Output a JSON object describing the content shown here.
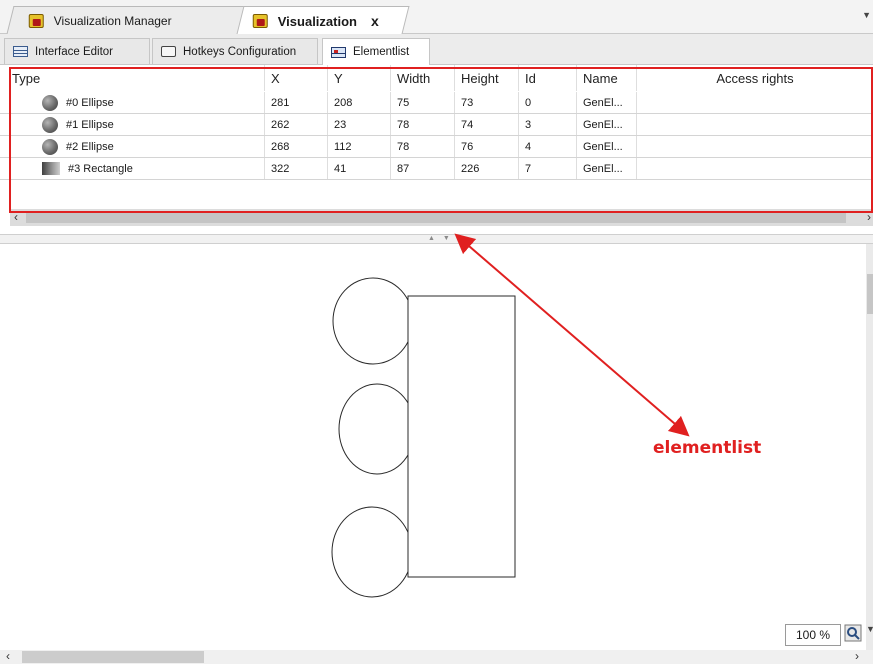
{
  "document_tabs": [
    {
      "label": "Visualization Manager",
      "icon": "visualization-manager-icon"
    },
    {
      "label": "Visualization",
      "icon": "visualization-icon",
      "active": true,
      "close": "x"
    }
  ],
  "editor_tabs": [
    {
      "label": "Interface Editor",
      "icon": "interface-editor-icon"
    },
    {
      "label": "Hotkeys Configuration",
      "icon": "keyboard-icon"
    },
    {
      "label": "Elementlist",
      "icon": "elementlist-icon",
      "active": true
    }
  ],
  "element_list": {
    "columns": [
      "Type",
      "X",
      "Y",
      "Width",
      "Height",
      "Id",
      "Name",
      "Access rights"
    ],
    "rows": [
      {
        "type": "#0 Ellipse",
        "icon": "ellipse-icon",
        "x": "281",
        "y": "208",
        "width": "75",
        "height": "73",
        "id": "0",
        "name": "GenEl...",
        "access": ""
      },
      {
        "type": "#1 Ellipse",
        "icon": "ellipse-icon",
        "x": "262",
        "y": "23",
        "width": "78",
        "height": "74",
        "id": "3",
        "name": "GenEl...",
        "access": ""
      },
      {
        "type": "#2 Ellipse",
        "icon": "ellipse-icon",
        "x": "268",
        "y": "112",
        "width": "78",
        "height": "76",
        "id": "4",
        "name": "GenEl...",
        "access": ""
      },
      {
        "type": "#3 Rectangle",
        "icon": "rectangle-icon",
        "x": "322",
        "y": "41",
        "width": "87",
        "height": "226",
        "id": "7",
        "name": "GenEl...",
        "access": ""
      }
    ]
  },
  "annotation": {
    "label": "elementlist",
    "color": "#e02020"
  },
  "zoom": {
    "value": "100 %"
  },
  "colors": {
    "highlight_red": "#e02020",
    "tab_background": "#ececec",
    "canvas_background": "#ffffff"
  }
}
